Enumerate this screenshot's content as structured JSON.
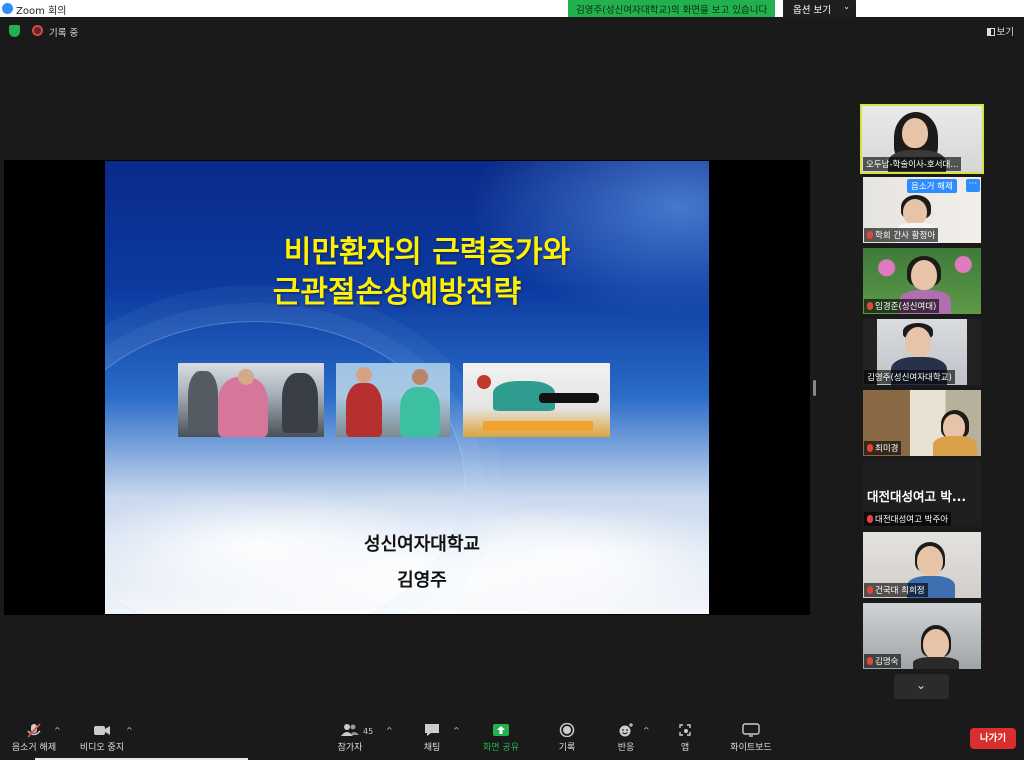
{
  "window": {
    "app_title": "Zoom 회의"
  },
  "share_banner": {
    "text": "김영주(성신여자대학교)의 화면을 보고 있습니다",
    "options_label": "옵션 보기"
  },
  "top_bar": {
    "recording_label": "기록 중",
    "view_label": "보기"
  },
  "slide": {
    "title_line1": "비만환자의 근력증가와",
    "title_line2": "근관절손상예방전략",
    "school": "성신여자대학교",
    "author": "김영주"
  },
  "gallery": {
    "tiles": [
      {
        "name": "오두남-학술이사-호서대..."
      },
      {
        "name": "학회 간사 황정아",
        "unmute_label": "음소거 해제",
        "more_label": "···"
      },
      {
        "name": "임경준(성신여대)"
      },
      {
        "name": "김영주(성신여자대학교)"
      },
      {
        "name": "최미경"
      },
      {
        "big_name": "대전대성여고 박...",
        "name": "대전대성여고 박주아"
      },
      {
        "name": "건국대 최희정"
      },
      {
        "name": "김명숙"
      }
    ]
  },
  "toolbar": {
    "mute_label": "음소거 해제",
    "video_label": "비디오 중지",
    "participants_label": "참가자",
    "participants_count": "45",
    "chat_label": "채팅",
    "share_label": "화면 공유",
    "record_label": "기록",
    "reactions_label": "반응",
    "apps_label": "앱",
    "whiteboard_label": "화이트보드",
    "leave_label": "나가기"
  },
  "colors": {
    "share_green": "#23b14d",
    "active_border": "#d8e23c",
    "zoom_blue": "#2d8cff",
    "leave_red": "#d92e2e",
    "slide_title": "#fff200"
  }
}
